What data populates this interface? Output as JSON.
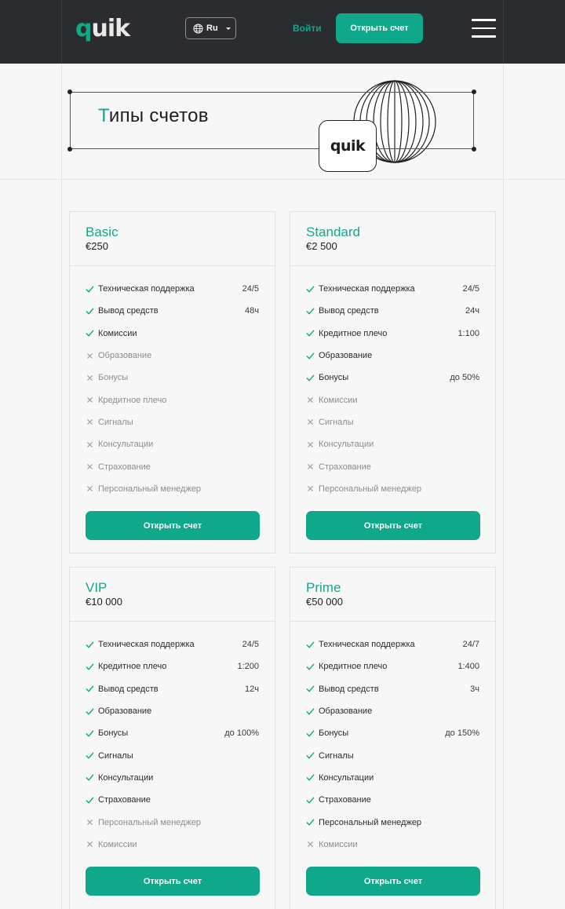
{
  "header": {
    "logo": "quik",
    "lang": "Ru",
    "login": "Войти",
    "open_account": "Открыть счет"
  },
  "hero": {
    "title_first_letter": "Т",
    "title_rest": "ипы счетов",
    "app_icon_text": "quik"
  },
  "cards": [
    {
      "name": "Basic",
      "price": "€250",
      "button": "Открыть счет",
      "features": [
        {
          "label": "Техническая поддержка",
          "value": "24/5",
          "included": true
        },
        {
          "label": "Вывод средств",
          "value": "48ч",
          "included": true
        },
        {
          "label": "Комиссии",
          "value": "",
          "included": true
        },
        {
          "label": "Образование",
          "value": "",
          "included": false
        },
        {
          "label": "Бонусы",
          "value": "",
          "included": false
        },
        {
          "label": "Кредитное плечо",
          "value": "",
          "included": false
        },
        {
          "label": "Сигналы",
          "value": "",
          "included": false
        },
        {
          "label": "Консультации",
          "value": "",
          "included": false
        },
        {
          "label": "Страхование",
          "value": "",
          "included": false
        },
        {
          "label": "Персональный менеджер",
          "value": "",
          "included": false
        }
      ]
    },
    {
      "name": "Standard",
      "price": "€2 500",
      "button": "Открыть счет",
      "features": [
        {
          "label": "Техническая поддержка",
          "value": "24/5",
          "included": true
        },
        {
          "label": "Вывод средств",
          "value": "24ч",
          "included": true
        },
        {
          "label": "Кредитное плечо",
          "value": "1:100",
          "included": true
        },
        {
          "label": "Образование",
          "value": "",
          "included": true
        },
        {
          "label": "Бонусы",
          "value": "до 50%",
          "included": true
        },
        {
          "label": "Комиссии",
          "value": "",
          "included": false
        },
        {
          "label": "Сигналы",
          "value": "",
          "included": false
        },
        {
          "label": "Консультации",
          "value": "",
          "included": false
        },
        {
          "label": "Страхование",
          "value": "",
          "included": false
        },
        {
          "label": "Персональный менеджер",
          "value": "",
          "included": false
        }
      ]
    },
    {
      "name": "VIP",
      "price": "€10 000",
      "button": "Открыть счет",
      "features": [
        {
          "label": "Техническая поддержка",
          "value": "24/5",
          "included": true
        },
        {
          "label": "Кредитное плечо",
          "value": "1:200",
          "included": true
        },
        {
          "label": "Вывод средств",
          "value": "12ч",
          "included": true
        },
        {
          "label": "Образование",
          "value": "",
          "included": true
        },
        {
          "label": "Бонусы",
          "value": "до 100%",
          "included": true
        },
        {
          "label": "Сигналы",
          "value": "",
          "included": true
        },
        {
          "label": "Консультации",
          "value": "",
          "included": true
        },
        {
          "label": "Страхование",
          "value": "",
          "included": true
        },
        {
          "label": "Персональный менеджер",
          "value": "",
          "included": false
        },
        {
          "label": "Комиссии",
          "value": "",
          "included": false
        }
      ]
    },
    {
      "name": "Prime",
      "price": "€50 000",
      "button": "Открыть счет",
      "features": [
        {
          "label": "Техническая поддержка",
          "value": "24/7",
          "included": true
        },
        {
          "label": "Кредитное плечо",
          "value": "1:400",
          "included": true
        },
        {
          "label": "Вывод средств",
          "value": "3ч",
          "included": true
        },
        {
          "label": "Образование",
          "value": "",
          "included": true
        },
        {
          "label": "Бонусы",
          "value": "до 150%",
          "included": true
        },
        {
          "label": "Сигналы",
          "value": "",
          "included": true
        },
        {
          "label": "Консультации",
          "value": "",
          "included": true
        },
        {
          "label": "Страхование",
          "value": "",
          "included": true
        },
        {
          "label": "Персональный менеджер",
          "value": "",
          "included": true
        },
        {
          "label": "Комиссии",
          "value": "",
          "included": false
        }
      ]
    }
  ],
  "colors": {
    "accent": "#10a88a",
    "header_bg": "#2b2c2f",
    "page_bg": "#f6f6f6"
  },
  "icons": {
    "included": "check-icon",
    "excluded": "cross-icon",
    "language": "globe-icon",
    "menu": "hamburger-menu-icon"
  }
}
